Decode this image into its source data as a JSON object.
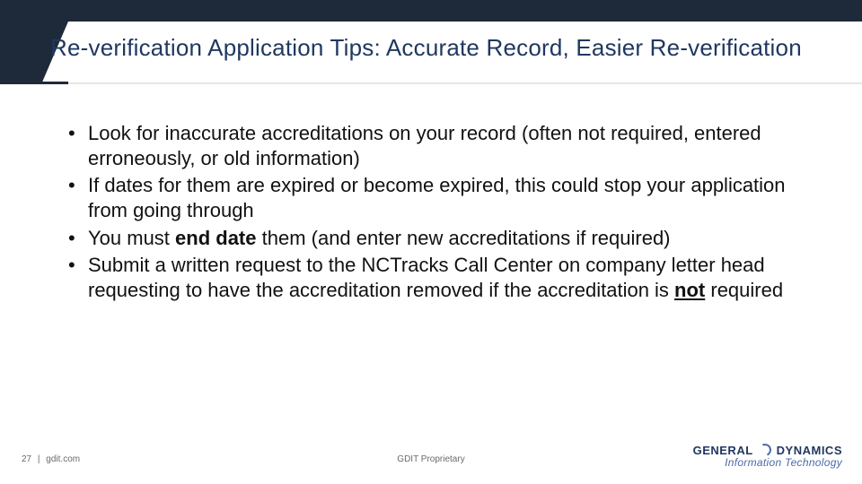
{
  "title": "Re-verification Application Tips: Accurate Record, Easier Re-verification",
  "bullets": [
    {
      "pre": "Look for inaccurate accreditations on your record (often not required, entered erroneously, or old information)"
    },
    {
      "pre": "If dates for them are expired or become expired, this could stop your application from going through"
    },
    {
      "pre": "You must ",
      "b1": "end date",
      "mid": " them (and enter new accreditations if required)"
    },
    {
      "pre": "Submit a written request to the NCTracks Call Center on company letter head requesting to have the accreditation removed if the accreditation is ",
      "bu": "not",
      "post": " required"
    }
  ],
  "footer": {
    "page": "27",
    "sep": "|",
    "site": "gdit.com",
    "proprietary": "GDIT Proprietary"
  },
  "logo": {
    "line1a": "GENERAL",
    "line1b": "DYNAMICS",
    "line2": "Information Technology"
  }
}
